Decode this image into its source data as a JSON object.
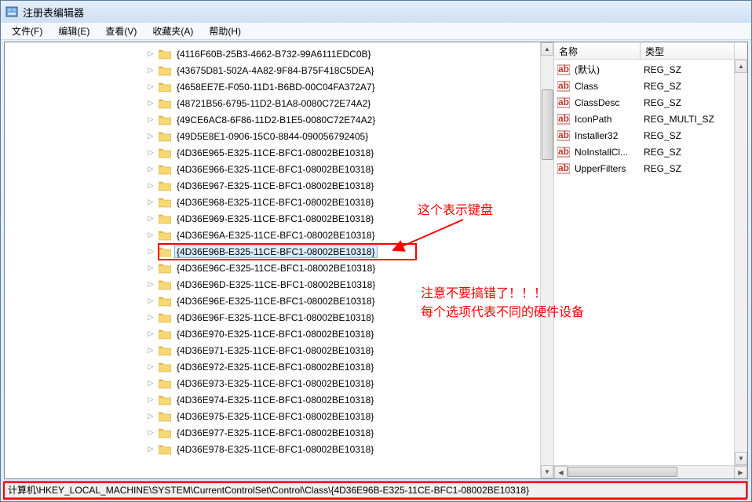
{
  "window": {
    "title": "注册表编辑器"
  },
  "menubar": [
    "文件(F)",
    "编辑(E)",
    "查看(V)",
    "收藏夹(A)",
    "帮助(H)"
  ],
  "tree": {
    "items": [
      {
        "label": "{4116F60B-25B3-4662-B732-99A6111EDC0B}",
        "selected": false
      },
      {
        "label": "{43675D81-502A-4A82-9F84-B75F418C5DEA}",
        "selected": false
      },
      {
        "label": "{4658EE7E-F050-11D1-B6BD-00C04FA372A7}",
        "selected": false
      },
      {
        "label": "{48721B56-6795-11D2-B1A8-0080C72E74A2}",
        "selected": false
      },
      {
        "label": "{49CE6AC8-6F86-11D2-B1E5-0080C72E74A2}",
        "selected": false
      },
      {
        "label": "{49D5E8E1-0906-15C0-8844-090056792405}",
        "selected": false
      },
      {
        "label": "{4D36E965-E325-11CE-BFC1-08002BE10318}",
        "selected": false
      },
      {
        "label": "{4D36E966-E325-11CE-BFC1-08002BE10318}",
        "selected": false
      },
      {
        "label": "{4D36E967-E325-11CE-BFC1-08002BE10318}",
        "selected": false
      },
      {
        "label": "{4D36E968-E325-11CE-BFC1-08002BE10318}",
        "selected": false
      },
      {
        "label": "{4D36E969-E325-11CE-BFC1-08002BE10318}",
        "selected": false
      },
      {
        "label": "{4D36E96A-E325-11CE-BFC1-08002BE10318}",
        "selected": false
      },
      {
        "label": "{4D36E96B-E325-11CE-BFC1-08002BE10318}",
        "selected": true
      },
      {
        "label": "{4D36E96C-E325-11CE-BFC1-08002BE10318}",
        "selected": false
      },
      {
        "label": "{4D36E96D-E325-11CE-BFC1-08002BE10318}",
        "selected": false
      },
      {
        "label": "{4D36E96E-E325-11CE-BFC1-08002BE10318}",
        "selected": false
      },
      {
        "label": "{4D36E96F-E325-11CE-BFC1-08002BE10318}",
        "selected": false
      },
      {
        "label": "{4D36E970-E325-11CE-BFC1-08002BE10318}",
        "selected": false
      },
      {
        "label": "{4D36E971-E325-11CE-BFC1-08002BE10318}",
        "selected": false
      },
      {
        "label": "{4D36E972-E325-11CE-BFC1-08002BE10318}",
        "selected": false
      },
      {
        "label": "{4D36E973-E325-11CE-BFC1-08002BE10318}",
        "selected": false
      },
      {
        "label": "{4D36E974-E325-11CE-BFC1-08002BE10318}",
        "selected": false
      },
      {
        "label": "{4D36E975-E325-11CE-BFC1-08002BE10318}",
        "selected": false
      },
      {
        "label": "{4D36E977-E325-11CE-BFC1-08002BE10318}",
        "selected": false
      },
      {
        "label": "{4D36E978-E325-11CE-BFC1-08002BE10318}",
        "selected": false
      }
    ]
  },
  "values": {
    "headers": {
      "name": "名称",
      "type": "类型"
    },
    "rows": [
      {
        "name": "(默认)",
        "type": "REG_SZ"
      },
      {
        "name": "Class",
        "type": "REG_SZ"
      },
      {
        "name": "ClassDesc",
        "type": "REG_SZ"
      },
      {
        "name": "IconPath",
        "type": "REG_MULTI_SZ"
      },
      {
        "name": "Installer32",
        "type": "REG_SZ"
      },
      {
        "name": "NoInstallCl...",
        "type": "REG_SZ"
      },
      {
        "name": "UpperFilters",
        "type": "REG_SZ"
      }
    ]
  },
  "statusbar": {
    "path": "计算机\\HKEY_LOCAL_MACHINE\\SYSTEM\\CurrentControlSet\\Control\\Class\\{4D36E96B-E325-11CE-BFC1-08002BE10318}"
  },
  "annotations": {
    "anno1": "这个表示键盘",
    "anno2": "注意不要搞错了！！！",
    "anno3": "每个选项代表不同的硬件设备"
  }
}
